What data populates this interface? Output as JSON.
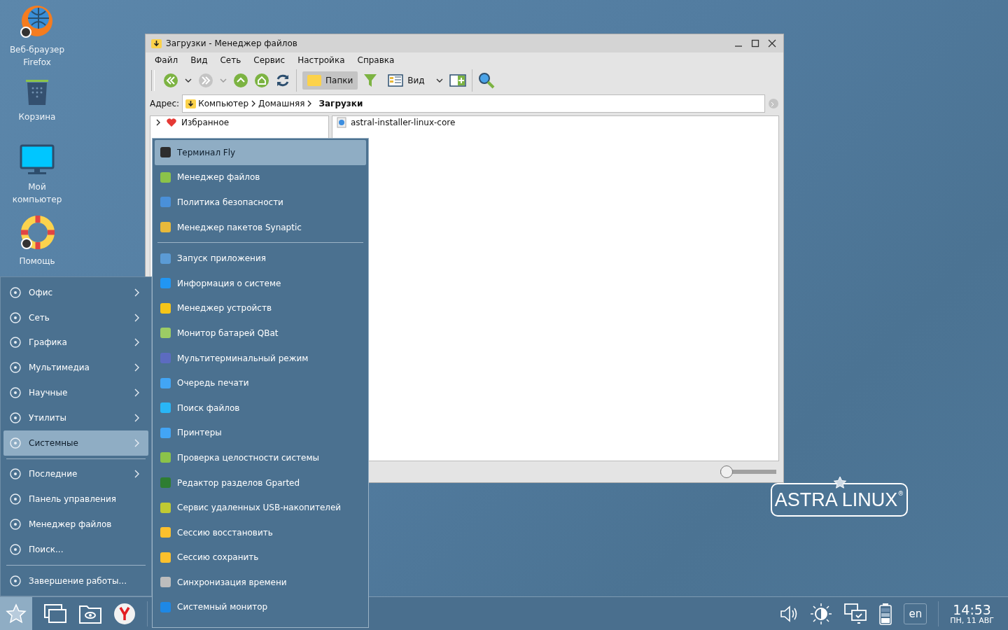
{
  "desktop_icons": [
    {
      "label": "Веб-браузер Firefox"
    },
    {
      "label": "Корзина"
    },
    {
      "label": "Мой компьютер"
    },
    {
      "label": "Помощь"
    }
  ],
  "window": {
    "title": "Загрузки - Менеджер файлов",
    "menu": [
      "Файл",
      "Вид",
      "Сеть",
      "Сервис",
      "Настройка",
      "Справка"
    ],
    "toolbar": {
      "folders_button": {
        "label": "Папки",
        "selected": true
      },
      "view_button": {
        "label": "Вид"
      }
    },
    "address": {
      "label": "Адрес:",
      "path": [
        {
          "label": "Компьютер",
          "current": false
        },
        {
          "label": "Домашняя",
          "current": false
        },
        {
          "label": "Загрузки",
          "current": true
        }
      ]
    },
    "tree": [
      {
        "label": "Избранное",
        "expanded": false
      }
    ],
    "files": [
      {
        "name": "astral-installer-linux-core"
      }
    ],
    "zoom_slider": {
      "level": 0
    }
  },
  "start_menu": {
    "groups": [
      [
        {
          "label": "Офис",
          "submenu": true,
          "selected": false
        },
        {
          "label": "Сеть",
          "submenu": true,
          "selected": false
        },
        {
          "label": "Графика",
          "submenu": true,
          "selected": false
        },
        {
          "label": "Мультимедиа",
          "submenu": true,
          "selected": false
        },
        {
          "label": "Научные",
          "submenu": true,
          "selected": false
        },
        {
          "label": "Утилиты",
          "submenu": true,
          "selected": false
        },
        {
          "label": "Системные",
          "submenu": true,
          "selected": true
        }
      ],
      [
        {
          "label": "Последние",
          "submenu": true,
          "selected": false
        },
        {
          "label": "Панель управления",
          "submenu": false,
          "selected": false
        },
        {
          "label": "Менеджер файлов",
          "submenu": false,
          "selected": false
        },
        {
          "label": "Поиск...",
          "submenu": false,
          "selected": false
        }
      ],
      [
        {
          "label": "Завершение работы...",
          "submenu": false,
          "selected": false
        }
      ]
    ]
  },
  "submenu": {
    "groups": [
      [
        {
          "label": "Терминал Fly",
          "selected": true
        },
        {
          "label": "Менеджер файлов",
          "selected": false
        },
        {
          "label": "Политика безопасности",
          "selected": false
        },
        {
          "label": "Менеджер пакетов Synaptic",
          "selected": false
        }
      ],
      [
        {
          "label": "Запуск приложения",
          "selected": false
        },
        {
          "label": "Информация о системе",
          "selected": false
        },
        {
          "label": "Менеджер устройств",
          "selected": false
        },
        {
          "label": "Монитор батарей QBat",
          "selected": false
        },
        {
          "label": "Мультитерминальный режим",
          "selected": false
        },
        {
          "label": "Очередь печати",
          "selected": false
        },
        {
          "label": "Поиск файлов",
          "selected": false
        },
        {
          "label": "Принтеры",
          "selected": false
        },
        {
          "label": "Проверка целостности системы",
          "selected": false
        },
        {
          "label": "Редактор разделов Gparted",
          "selected": false
        },
        {
          "label": "Сервис удаленных USB-накопителей",
          "selected": false
        },
        {
          "label": "Сессию восстановить",
          "selected": false
        },
        {
          "label": "Сессию сохранить",
          "selected": false
        },
        {
          "label": "Синхронизация времени",
          "selected": false
        },
        {
          "label": "Системный монитор",
          "selected": false
        }
      ]
    ]
  },
  "logo": {
    "text": "ASTRA LINUX",
    "mark": "®"
  },
  "taskbar": {
    "start_selected": true,
    "language": "en",
    "time": "14:53",
    "date": "ПН, 11 АВГ"
  }
}
